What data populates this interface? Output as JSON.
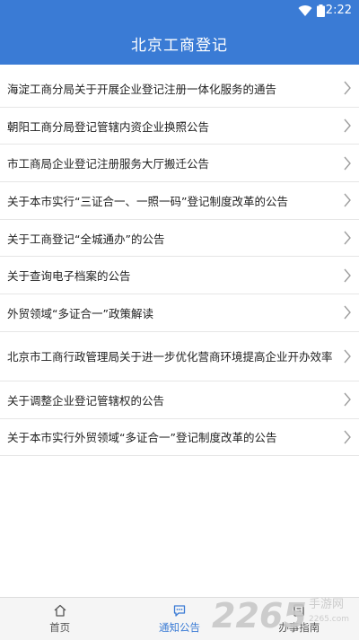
{
  "status_bar": {
    "time": "2:22"
  },
  "app_bar": {
    "title": "北京工商登记"
  },
  "list": {
    "items": [
      {
        "label": "海淀工商分局关于开展企业登记注册一体化服务的通告"
      },
      {
        "label": "朝阳工商分局登记管辖内资企业换照公告"
      },
      {
        "label": "市工商局企业登记注册服务大厅搬迁公告"
      },
      {
        "label": "关于本市实行“三证合一、一照一码”登记制度改革的公告"
      },
      {
        "label": "关于工商登记“全城通办”的公告"
      },
      {
        "label": "关于查询电子档案的公告"
      },
      {
        "label": "外贸领域“多证合一”政策解读"
      },
      {
        "label": "北京市工商行政管理局关于进一步优化营商环境提高企业开办效率的公告"
      },
      {
        "label": "关于调整企业登记管辖权的公告"
      },
      {
        "label": "关于本市实行外贸领域“多证合一”登记制度改革的公告"
      }
    ]
  },
  "tab_bar": {
    "tabs": [
      {
        "label": "首页",
        "icon": "home-icon"
      },
      {
        "label": "通知公告",
        "icon": "chat-icon",
        "active": true
      },
      {
        "label": "办事指南",
        "icon": "guide-icon"
      }
    ]
  },
  "watermark": {
    "number": "2265",
    "text": "手游网",
    "sub": "2265.com"
  },
  "colors": {
    "primary": "#3a7bd5",
    "text": "#222222",
    "divider": "#e6e6e6",
    "chevron": "#9e9e9e"
  }
}
